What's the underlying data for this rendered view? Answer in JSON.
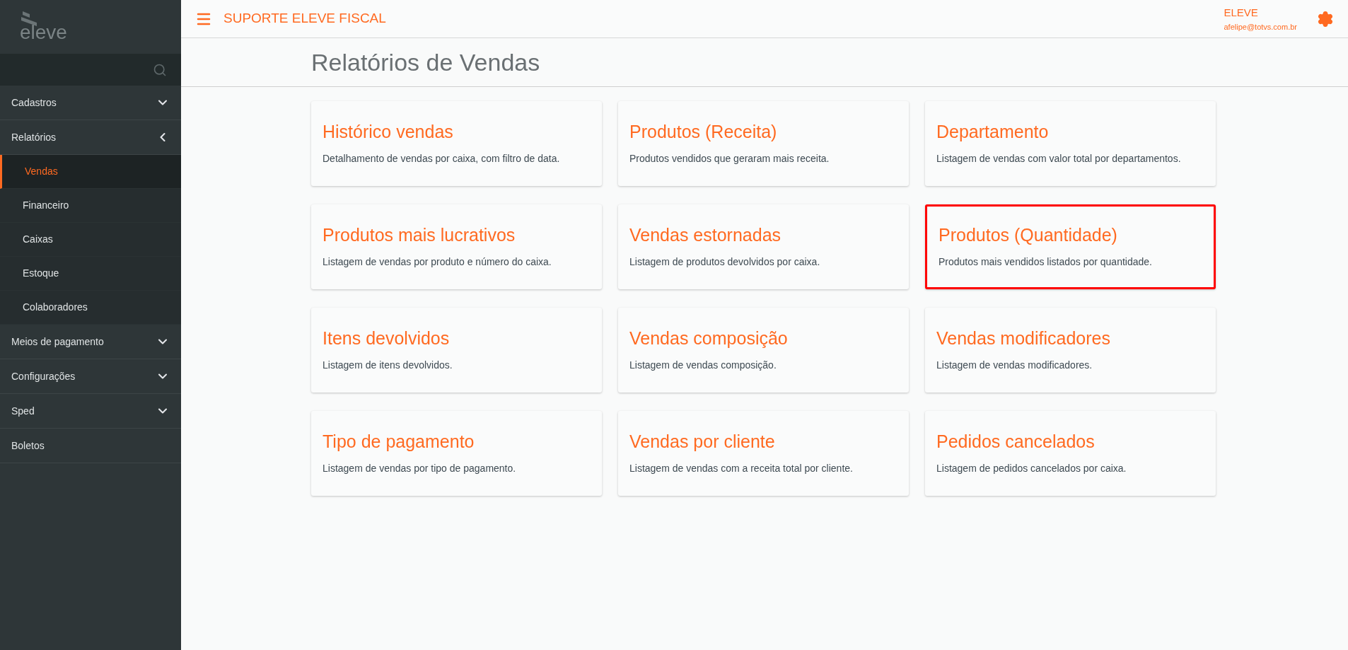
{
  "sidebar": {
    "logo": "eleve",
    "items": [
      {
        "label": "Cadastros",
        "kind": "group",
        "expanded": false,
        "selected": false
      },
      {
        "label": "Relatórios",
        "kind": "group",
        "expanded": true,
        "selected": false,
        "children": [
          {
            "label": "Vendas",
            "selected": true
          },
          {
            "label": "Financeiro",
            "selected": false
          },
          {
            "label": "Caixas",
            "selected": false
          },
          {
            "label": "Estoque",
            "selected": false
          },
          {
            "label": "Colaboradores",
            "selected": false
          }
        ]
      },
      {
        "label": "Meios de pagamento",
        "kind": "group",
        "expanded": false,
        "selected": false
      },
      {
        "label": "Configurações",
        "kind": "group",
        "expanded": false,
        "selected": false
      },
      {
        "label": "Sped",
        "kind": "group",
        "expanded": false,
        "selected": false
      },
      {
        "label": "Boletos",
        "kind": "link",
        "selected": false
      }
    ]
  },
  "header": {
    "title": "SUPORTE ELEVE FISCAL",
    "user": "ELEVE",
    "email": "afelipe@totvs.com.br"
  },
  "page_title": "Relatórios de Vendas",
  "cards": [
    {
      "title": "Histórico vendas",
      "description": "Detalhamento de vendas por caixa, com filtro de data.",
      "highlighted": false
    },
    {
      "title": "Produtos (Receita)",
      "description": "Produtos vendidos que geraram mais receita.",
      "highlighted": false
    },
    {
      "title": "Departamento",
      "description": "Listagem de vendas com valor total por departamentos.",
      "highlighted": false
    },
    {
      "title": "Produtos mais lucrativos",
      "description": "Listagem de vendas por produto e número do caixa.",
      "highlighted": false
    },
    {
      "title": "Vendas estornadas",
      "description": "Listagem de produtos devolvidos por caixa.",
      "highlighted": false
    },
    {
      "title": "Produtos (Quantidade)",
      "description": "Produtos mais vendidos listados por quantidade.",
      "highlighted": true
    },
    {
      "title": "Itens devolvidos",
      "description": "Listagem de itens devolvidos.",
      "highlighted": false
    },
    {
      "title": "Vendas composição",
      "description": "Listagem de vendas composição.",
      "highlighted": false
    },
    {
      "title": "Vendas modificadores",
      "description": "Listagem de vendas modificadores.",
      "highlighted": false
    },
    {
      "title": "Tipo de pagamento",
      "description": "Listagem de vendas por tipo de pagamento.",
      "highlighted": false
    },
    {
      "title": "Vendas por cliente",
      "description": "Listagem de vendas com a receita total por cliente.",
      "highlighted": false
    },
    {
      "title": "Pedidos cancelados",
      "description": "Listagem de pedidos cancelados por caixa.",
      "highlighted": false
    }
  ]
}
